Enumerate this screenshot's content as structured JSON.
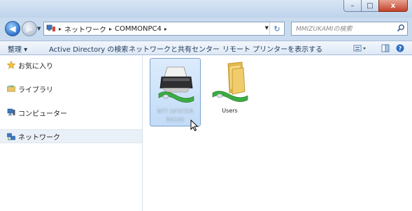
{
  "window": {
    "controls": {
      "minimize": "–",
      "maximize": "□",
      "close": "x"
    }
  },
  "address": {
    "crumbs": [
      "ネットワーク",
      "COMMONPC4"
    ],
    "search_placeholder": "MMIZUKAMIの検索"
  },
  "toolbar": {
    "organize": "整理 ▾",
    "ad_search": "Active Directory の検索",
    "network_center": "ネットワークと共有センター",
    "remote_printers": "リモート プリンターを表示する"
  },
  "navpane": {
    "items": [
      {
        "label": "お気に入り",
        "icon": "star-icon"
      },
      {
        "label": "ライブラリ",
        "icon": "library-icon"
      },
      {
        "label": "コンピューター",
        "icon": "computer-icon"
      },
      {
        "label": "ネットワーク",
        "icon": "network-icon",
        "selected": true
      }
    ]
  },
  "files": [
    {
      "label_line1": "NTT OFISTER",
      "label_line2": "B4100",
      "type": "shared-printer",
      "selected": true,
      "blurred": true
    },
    {
      "label_line1": "Users",
      "label_line2": "",
      "type": "shared-folder",
      "selected": false
    }
  ],
  "colors": {
    "accent": "#3a76c2",
    "selection": "#cde3fa",
    "close": "#c2422a"
  }
}
